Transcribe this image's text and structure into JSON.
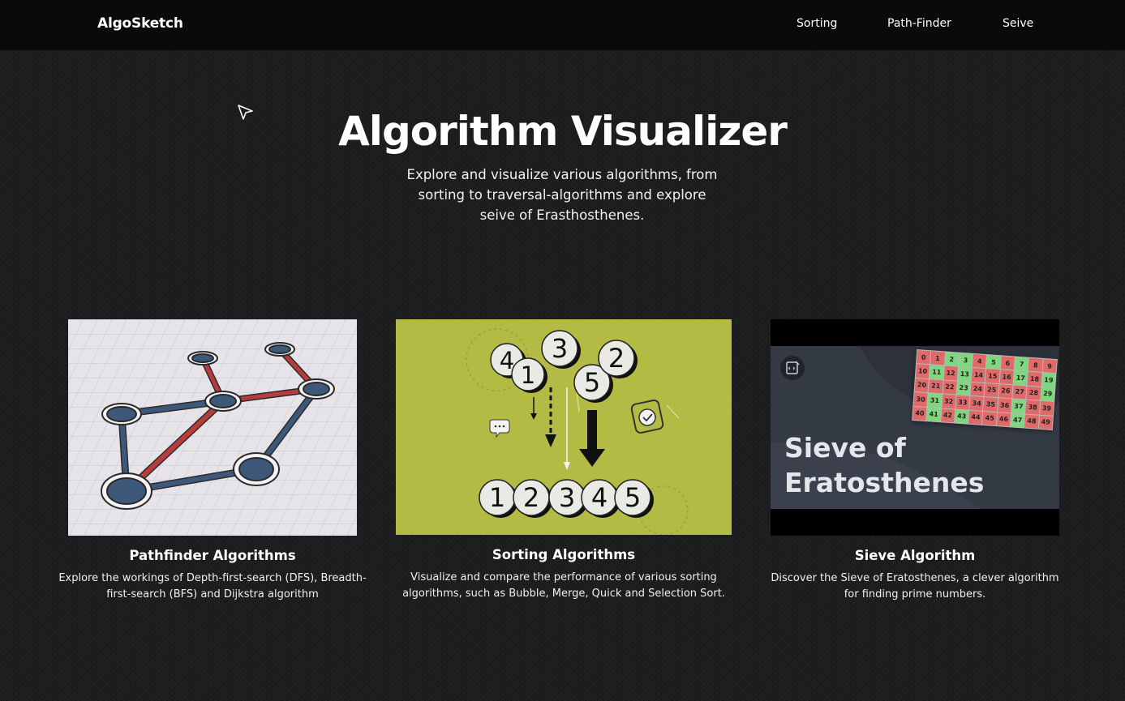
{
  "nav": {
    "brand": "AlgoSketch",
    "links": [
      "Sorting",
      "Path-Finder",
      "Seive"
    ]
  },
  "hero": {
    "title": "Algorithm Visualizer",
    "subtitle": "Explore and visualize various algorithms, from sorting to traversal-algorithms and explore seive of Erasthosthenes."
  },
  "cards": [
    {
      "title": "Pathfinder Algorithms",
      "description": "Explore the workings of Depth-first-search (DFS), Breadth-first-search (BFS) and Dijkstra algorithm"
    },
    {
      "title": "Sorting Algorithms",
      "description": "Visualize and compare the performance of various sorting algorithms, such as Bubble, Merge, Quick and Selection Sort."
    },
    {
      "title": "Sieve Algorithm",
      "description": "Discover the Sieve of Eratosthenes, a clever algorithm for finding prime numbers."
    }
  ],
  "sorting_image": {
    "scattered": [
      "4",
      "1",
      "3",
      "5",
      "2"
    ],
    "sorted": [
      "1",
      "2",
      "3",
      "4",
      "5"
    ]
  },
  "sieve_image": {
    "caption_line1": "Sieve of",
    "caption_line2": "Eratosthenes",
    "grid": [
      "0",
      "1",
      "2",
      "3",
      "4",
      "5",
      "6",
      "7",
      "8",
      "9",
      "10",
      "11",
      "12",
      "13",
      "14",
      "15",
      "16",
      "17",
      "18",
      "19",
      "20",
      "21",
      "22",
      "23",
      "24",
      "25",
      "26",
      "27",
      "28",
      "29",
      "30",
      "31",
      "32",
      "33",
      "34",
      "35",
      "36",
      "37",
      "38",
      "39",
      "40",
      "41",
      "42",
      "43",
      "44",
      "45",
      "46",
      "47",
      "48",
      "49"
    ]
  },
  "colors": {
    "background": "#1b1c1e",
    "navbar": "#0a0a0a",
    "sorting_bg": "#b3bb45",
    "path_red": "#b83c3c",
    "path_blue": "#3d5878",
    "prime_green": "#7ed67e",
    "composite_red": "#e06a6a"
  }
}
